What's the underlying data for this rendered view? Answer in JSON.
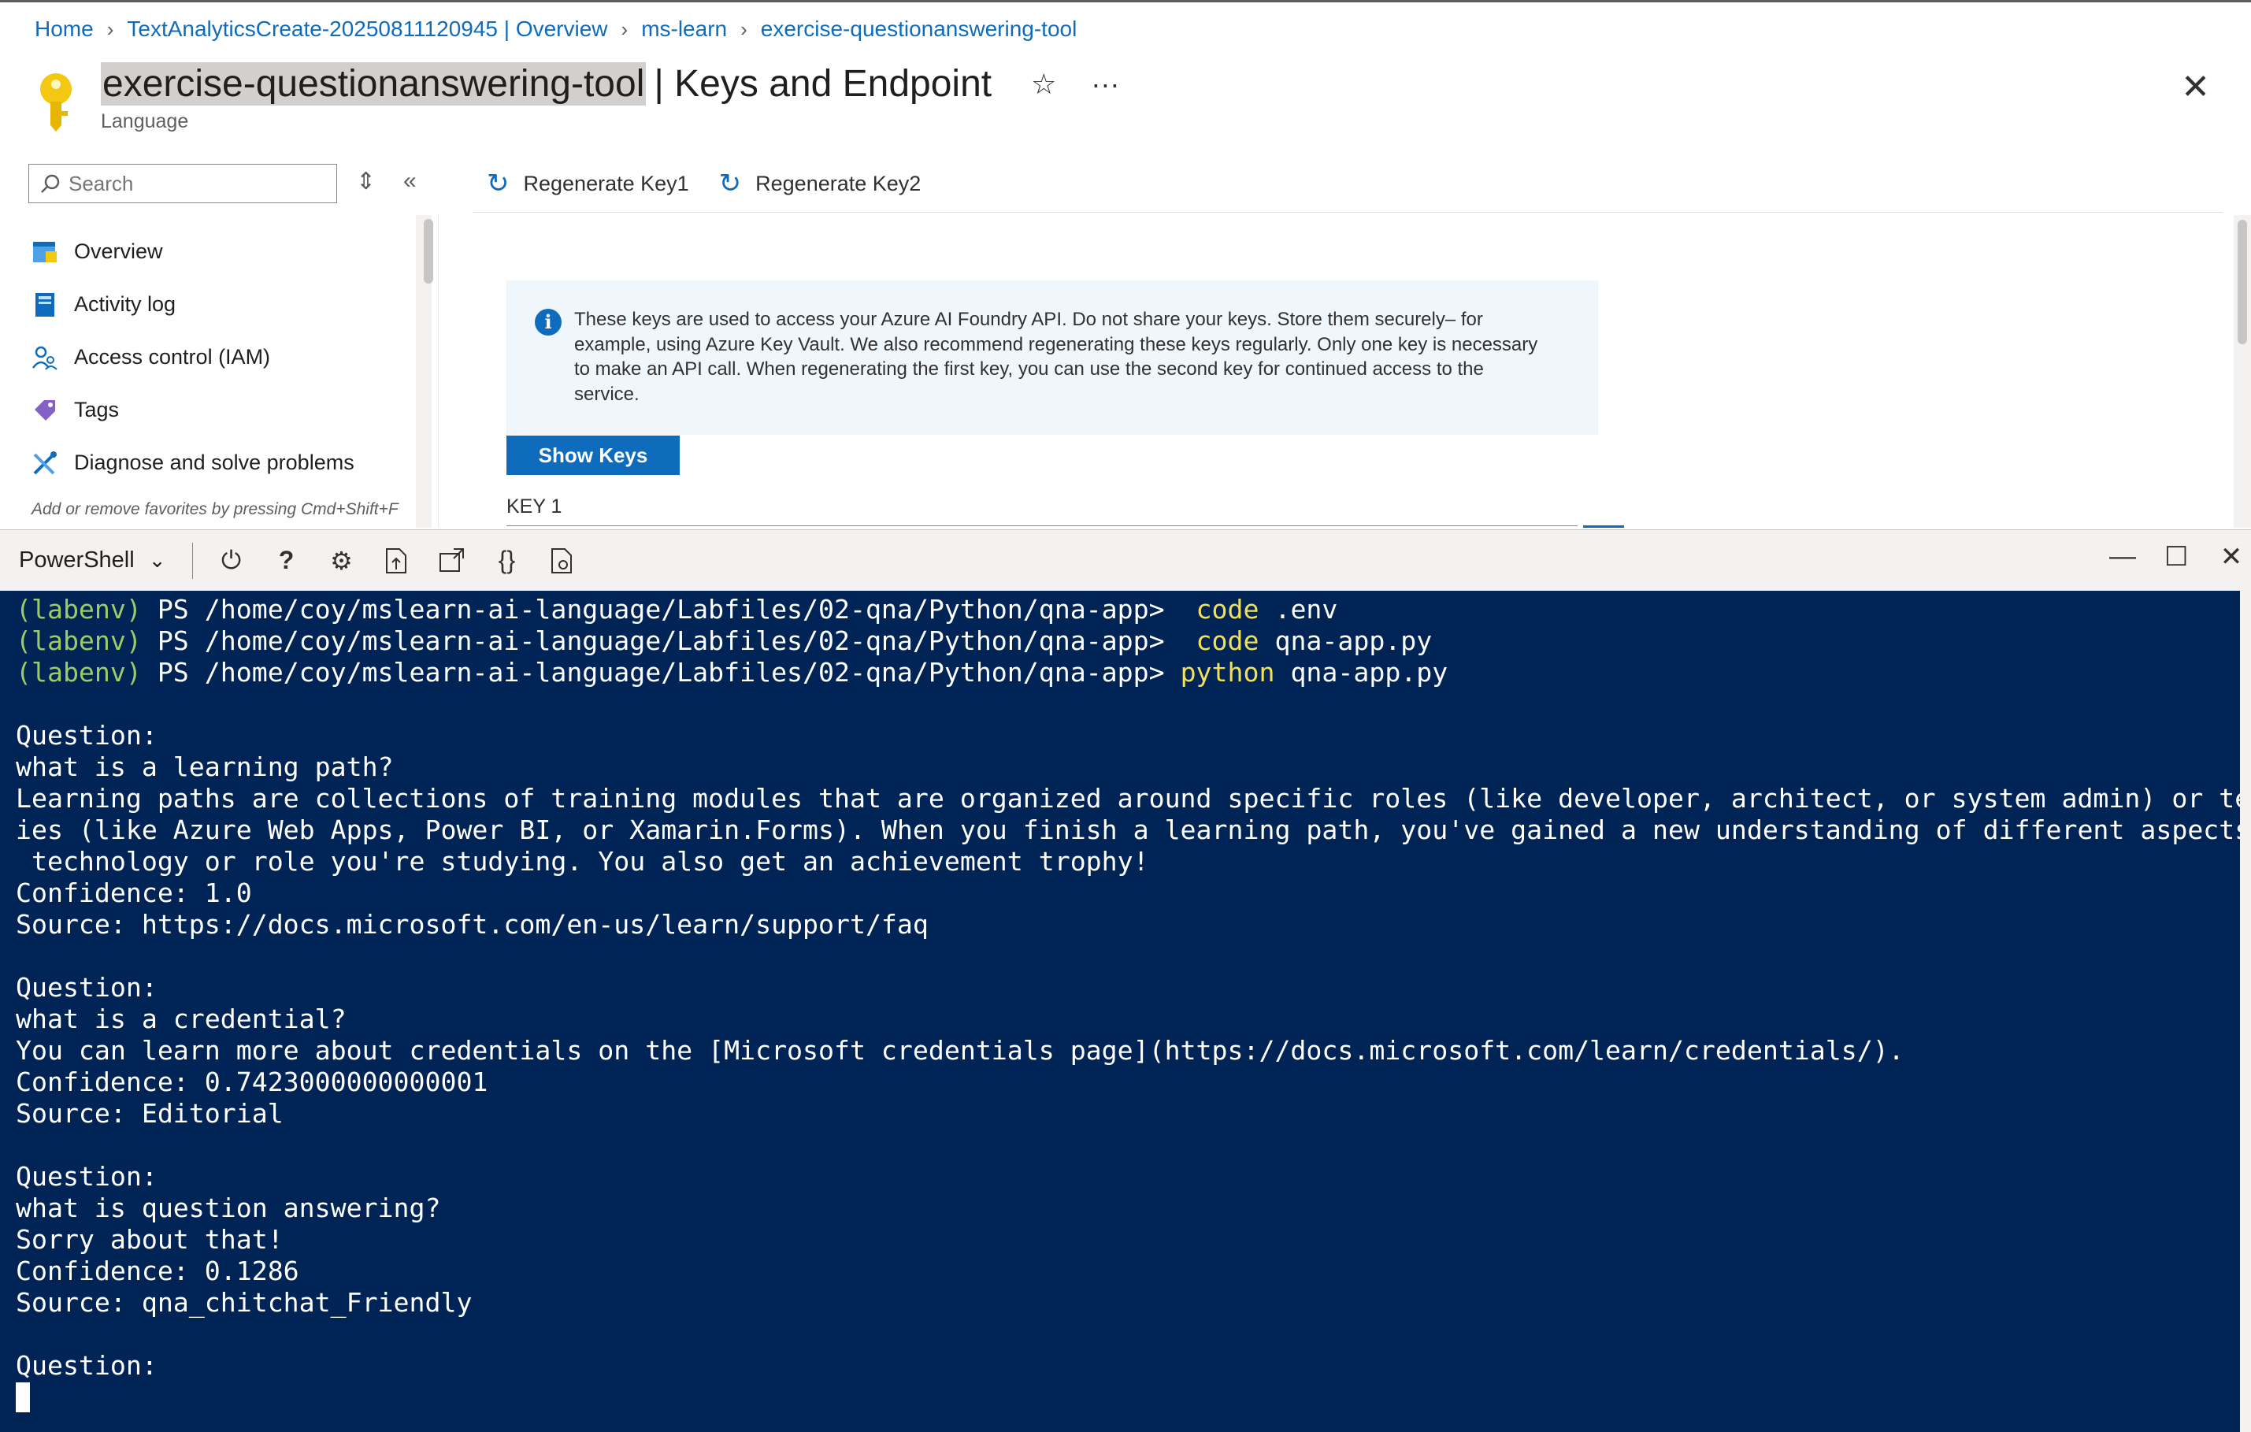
{
  "breadcrumb": [
    {
      "label": "Home"
    },
    {
      "label": "TextAnalyticsCreate-20250811120945 | Overview"
    },
    {
      "label": "ms-learn"
    },
    {
      "label": "exercise-questionanswering-tool"
    }
  ],
  "header": {
    "resource_name": "exercise-questionanswering-tool",
    "page_suffix": "| Keys and Endpoint",
    "subtitle": "Language",
    "star_glyph": "☆",
    "more_glyph": "···",
    "close_glyph": "✕"
  },
  "sidebar": {
    "search_placeholder": "Search",
    "items": [
      {
        "label": "Overview",
        "icon": "overview-icon"
      },
      {
        "label": "Activity log",
        "icon": "activity-log-icon"
      },
      {
        "label": "Access control (IAM)",
        "icon": "iam-icon"
      },
      {
        "label": "Tags",
        "icon": "tag-icon"
      },
      {
        "label": "Diagnose and solve problems",
        "icon": "wrench-icon"
      }
    ],
    "favorites_hint": "Add or remove favorites by pressing Cmd+Shift+F"
  },
  "toolbar": {
    "regen_key1": "Regenerate Key1",
    "regen_key2": "Regenerate Key2"
  },
  "info": {
    "text": "These keys are used to access your Azure AI Foundry API. Do not share your keys. Store them securely– for example, using Azure Key Vault. We also recommend regenerating these keys regularly. Only one key is necessary to make an API call. When regenerating the first key, you can use the second key for continued access to the service.",
    "lines": [
      "These keys are used to access your Azure AI Foundry API. Do not share your keys. Store them securely– for",
      "example, using Azure Key Vault. We also recommend regenerating these keys regularly. Only one key is necessary",
      "to make an API call. When regenerating the first key, you can use the second key for continued access to the",
      "service."
    ]
  },
  "show_keys_label": "Show Keys",
  "key1_label": "KEY 1",
  "shell": {
    "type": "PowerShell",
    "tools": [
      "power-icon",
      "help-icon",
      "settings-icon",
      "upload-download-icon",
      "open-new-session-icon",
      "editor-braces-icon",
      "preview-port-icon"
    ]
  },
  "terminal": {
    "lines": [
      [
        {
          "t": "(labenv) ",
          "c": "green"
        },
        {
          "t": "PS /home/coy/mslearn-ai-language/Labfiles/02-qna/Python/qna-app> ",
          "c": "white"
        },
        {
          "t": " code",
          "c": "yellow"
        },
        {
          "t": " .env",
          "c": "white"
        }
      ],
      [
        {
          "t": "(labenv) ",
          "c": "green"
        },
        {
          "t": "PS /home/coy/mslearn-ai-language/Labfiles/02-qna/Python/qna-app> ",
          "c": "white"
        },
        {
          "t": " code",
          "c": "yellow"
        },
        {
          "t": " qna-app.py",
          "c": "white"
        }
      ],
      [
        {
          "t": "(labenv) ",
          "c": "green"
        },
        {
          "t": "PS /home/coy/mslearn-ai-language/Labfiles/02-qna/Python/qna-app> ",
          "c": "white"
        },
        {
          "t": "python",
          "c": "yellow"
        },
        {
          "t": " qna-app.py",
          "c": "white"
        }
      ],
      [
        {
          "t": "",
          "c": "white"
        }
      ],
      [
        {
          "t": "Question:",
          "c": "white"
        }
      ],
      [
        {
          "t": "what is a learning path?",
          "c": "white"
        }
      ],
      [
        {
          "t": "Learning paths are collections of training modules that are organized around specific roles (like developer, architect, or system admin) or technolog",
          "c": "white"
        }
      ],
      [
        {
          "t": "ies (like Azure Web Apps, Power BI, or Xamarin.Forms). When you finish a learning path, you've gained a new understanding of different aspects of the",
          "c": "white"
        }
      ],
      [
        {
          "t": " technology or role you're studying. You also get an achievement trophy!",
          "c": "white"
        }
      ],
      [
        {
          "t": "Confidence: 1.0",
          "c": "white"
        }
      ],
      [
        {
          "t": "Source: https://docs.microsoft.com/en-us/learn/support/faq",
          "c": "white"
        }
      ],
      [
        {
          "t": "",
          "c": "white"
        }
      ],
      [
        {
          "t": "Question:",
          "c": "white"
        }
      ],
      [
        {
          "t": "what is a credential?",
          "c": "white"
        }
      ],
      [
        {
          "t": "You can learn more about credentials on the [Microsoft credentials page](https://docs.microsoft.com/learn/credentials/).",
          "c": "white"
        }
      ],
      [
        {
          "t": "Confidence: 0.7423000000000001",
          "c": "white"
        }
      ],
      [
        {
          "t": "Source: Editorial",
          "c": "white"
        }
      ],
      [
        {
          "t": "",
          "c": "white"
        }
      ],
      [
        {
          "t": "Question:",
          "c": "white"
        }
      ],
      [
        {
          "t": "what is question answering?",
          "c": "white"
        }
      ],
      [
        {
          "t": "Sorry about that!",
          "c": "white"
        }
      ],
      [
        {
          "t": "Confidence: 0.1286",
          "c": "white"
        }
      ],
      [
        {
          "t": "Source: qna_chitchat_Friendly",
          "c": "white"
        }
      ],
      [
        {
          "t": "",
          "c": "white"
        }
      ],
      [
        {
          "t": "Question:",
          "c": "white"
        }
      ]
    ]
  },
  "colors": {
    "terminal_bg": "#012456",
    "accent": "#0f6cbd",
    "prompt_green": "#9ccc65",
    "command_yellow": "#f1e05a"
  }
}
